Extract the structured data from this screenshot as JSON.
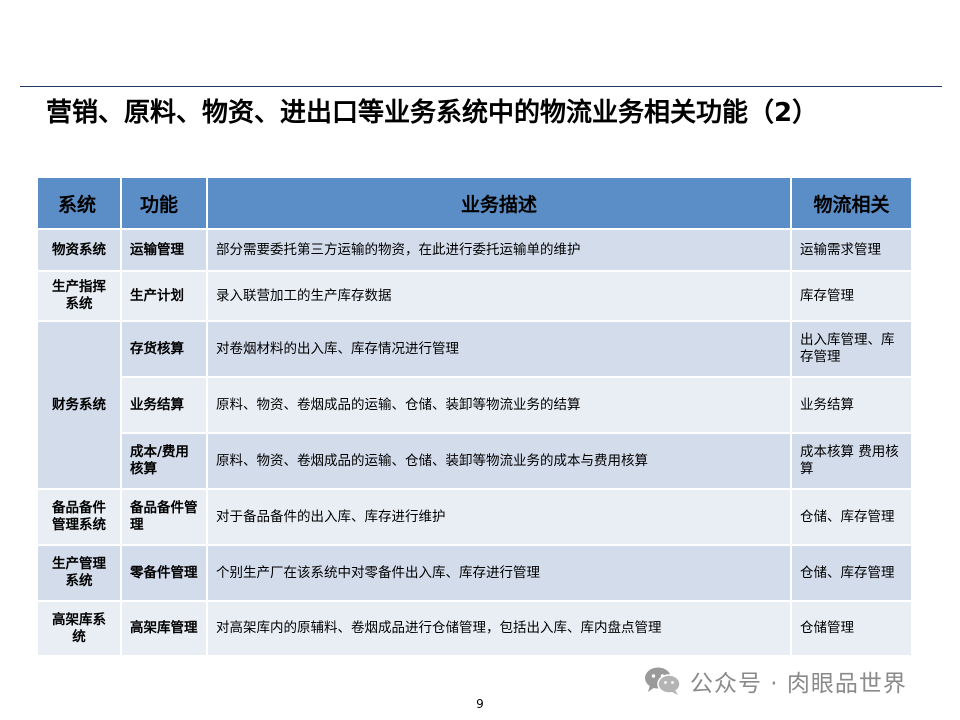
{
  "title": "营销、原料、物资、进出口等业务系统中的物流业务相关功能（2）",
  "table": {
    "headers": {
      "system": "系统",
      "function": "功能",
      "description": "业务描述",
      "logistics": "物流相关"
    },
    "rows": [
      {
        "system": "物资系统",
        "function": "运输管理",
        "description": "部分需要委托第三方运输的物资，在此进行委托运输单的维护",
        "logistics": "运输需求管理"
      },
      {
        "system": "生产指挥系统",
        "function": "生产计划",
        "description": "录入联营加工的生产库存数据",
        "logistics": "库存管理"
      },
      {
        "system": "财务系统",
        "function": "存货核算",
        "description": "对卷烟材料的出入库、库存情况进行管理",
        "logistics": "出入库管理、库存管理"
      },
      {
        "system": "",
        "function": "业务结算",
        "description": "原料、物资、卷烟成品的运输、仓储、装卸等物流业务的结算",
        "logistics": "业务结算"
      },
      {
        "system": "",
        "function": "成本/费用核算",
        "description": "原料、物资、卷烟成品的运输、仓储、装卸等物流业务的成本与费用核算",
        "logistics": "成本核算 费用核算"
      },
      {
        "system": "备品备件管理系统",
        "function": "备品备件管理",
        "description": "对于备品备件的出入库、库存进行维护",
        "logistics": "仓储、库存管理"
      },
      {
        "system": "生产管理系统",
        "function": "零备件管理",
        "description": "个别生产厂在该系统中对零备件出入库、库存进行管理",
        "logistics": "仓储、库存管理"
      },
      {
        "system": "高架库系统",
        "function": "高架库管理",
        "description": "对高架库内的原辅料、卷烟成品进行仓储管理，包括出入库、库内盘点管理",
        "logistics": "仓储管理"
      }
    ]
  },
  "watermark": {
    "text": "公众号 · 肉眼品世界",
    "icon": "wechat-icon"
  },
  "page_number": "9",
  "colors": {
    "header": "#5b8ec6",
    "band_dark": "#d3dceb",
    "band_light": "#e9eef5",
    "rule": "#1f3864"
  }
}
